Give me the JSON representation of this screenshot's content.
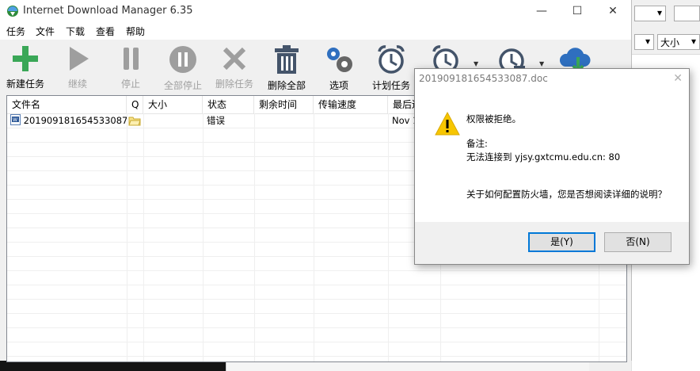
{
  "window": {
    "title": "Internet Download Manager 6.35",
    "minimize": "—",
    "maximize": "☐",
    "close": "✕"
  },
  "menu": [
    "任务",
    "文件",
    "下载",
    "查看",
    "帮助"
  ],
  "toolbar": {
    "add": "新建任务",
    "resume": "继续",
    "stop": "停止",
    "stop_all": "全部停止",
    "delete": "删除任务",
    "delete_all": "删除全部",
    "options": "选项",
    "scheduler": "计划任务"
  },
  "list": {
    "columns": [
      "文件名",
      "Q",
      "大小",
      "状态",
      "剩余时间",
      "传输速度",
      "最后连"
    ],
    "rows": [
      {
        "filename": "201909181654533087....",
        "size": "",
        "status": "错误",
        "time_left": "",
        "speed": "",
        "last": "Nov 1"
      }
    ]
  },
  "dialog": {
    "title": "201909181654533087.doc",
    "message": "权限被拒绝。",
    "note_label": "备注:",
    "note": "无法连接到 yjsy.gxtcmu.edu.cn: 80",
    "question": "关于如何配置防火墙，您是否想阅读详细的说明？",
    "yes": "是(Y)",
    "no": "否(N)",
    "close": "✕"
  },
  "background_window": {
    "combo1_arrow": "▾",
    "combo2_arrow": "▾",
    "combo3_text": "大小",
    "combo3_arrow": "▾"
  },
  "colors": {
    "accent_green": "#3aa757",
    "disabled_gray": "#9e9e9e",
    "dark_icon": "#44546a",
    "warning_yellow": "#f7c600",
    "default_button_border": "#0078d7"
  }
}
